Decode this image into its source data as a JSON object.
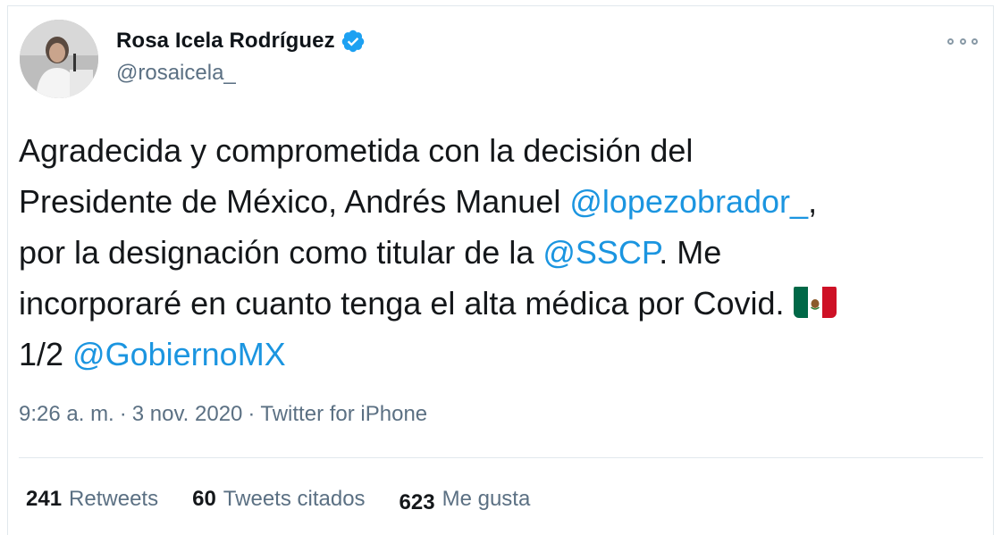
{
  "author": {
    "display_name": "Rosa Icela Rodríguez",
    "handle": "@rosaicela_",
    "verified_icon": "verified-badge-icon",
    "avatar_icon": "avatar-photo"
  },
  "more_icon": "more-options-icon",
  "tweet": {
    "line1": "Agradecida y comprometida con la decisión del",
    "line2_prefix": "Presidente de México, Andrés Manuel ",
    "mention1": "@lopezobrador_",
    "line2_suffix": ",",
    "line3_prefix": "por la designación como titular de la ",
    "mention2": "@SSCP",
    "line3_suffix": ". Me",
    "line4": "incorporaré en cuanto tenga el alta médica por Covid.",
    "flag_icon": "mexico-flag-icon",
    "line5_prefix": "1/2 ",
    "mention3": "@GobiernoMX"
  },
  "meta": {
    "time": "9:26 a. m.",
    "separator": "·",
    "date": "3 nov. 2020",
    "source": "Twitter for iPhone"
  },
  "stats": {
    "retweets_count": "241",
    "retweets_label": "Retweets",
    "quotes_count": "60",
    "quotes_label": "Tweets citados",
    "likes_count": "623",
    "likes_label": "Me gusta"
  },
  "colors": {
    "link": "#1b95e0",
    "secondary": "#5b7083",
    "verified": "#1da1f2"
  }
}
